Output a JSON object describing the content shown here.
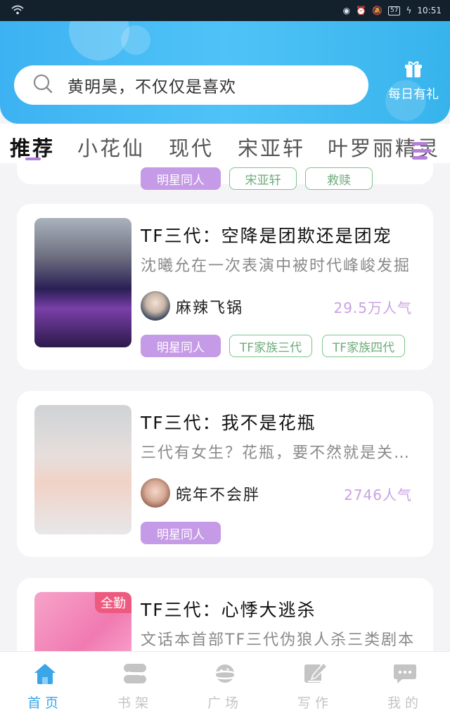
{
  "status_bar": {
    "time": "10:51",
    "battery": "57"
  },
  "search": {
    "placeholder": "黄明昊，不仅仅是喜欢"
  },
  "daily_gift": {
    "label": "每日有礼"
  },
  "tabs": [
    "推荐",
    "小花仙",
    "现代",
    "宋亚轩",
    "叶罗丽精灵"
  ],
  "active_tab": 0,
  "partial_card": {
    "tags": [
      "明星同人",
      "宋亚轩",
      "救赎"
    ]
  },
  "cards": [
    {
      "title": "TF三代：空降是团欺还是团宠",
      "description": "沈曦允在一次表演中被时代峰峻发掘",
      "author": "麻辣飞锅",
      "popularity": "29.5万人气",
      "tags": [
        "明星同人",
        "TF家族三代",
        "TF家族四代"
      ]
    },
    {
      "title": "TF三代：我不是花瓶",
      "description": "三代有女生？花瓶，要不然就是关系户",
      "author": "皖年不会胖",
      "popularity": "2746人气",
      "tags": [
        "明星同人"
      ]
    },
    {
      "title": "TF三代：心悸大逃杀",
      "description": "文话本首部TF三代伪狼人杀三类剧本",
      "badge": "全勤"
    }
  ],
  "nav": [
    {
      "label": "首页",
      "icon": "home-icon",
      "active": true
    },
    {
      "label": "书架",
      "icon": "bookshelf-icon",
      "active": false
    },
    {
      "label": "广场",
      "icon": "planet-icon",
      "active": false
    },
    {
      "label": "写作",
      "icon": "pen-icon",
      "active": false
    },
    {
      "label": "我的",
      "icon": "chat-bubble-icon",
      "active": false
    }
  ],
  "colors": {
    "accent": "#3aa6e8",
    "tag_purple": "#c59ae6",
    "tag_green": "#7bc48a",
    "popularity": "#c9a2e2"
  }
}
